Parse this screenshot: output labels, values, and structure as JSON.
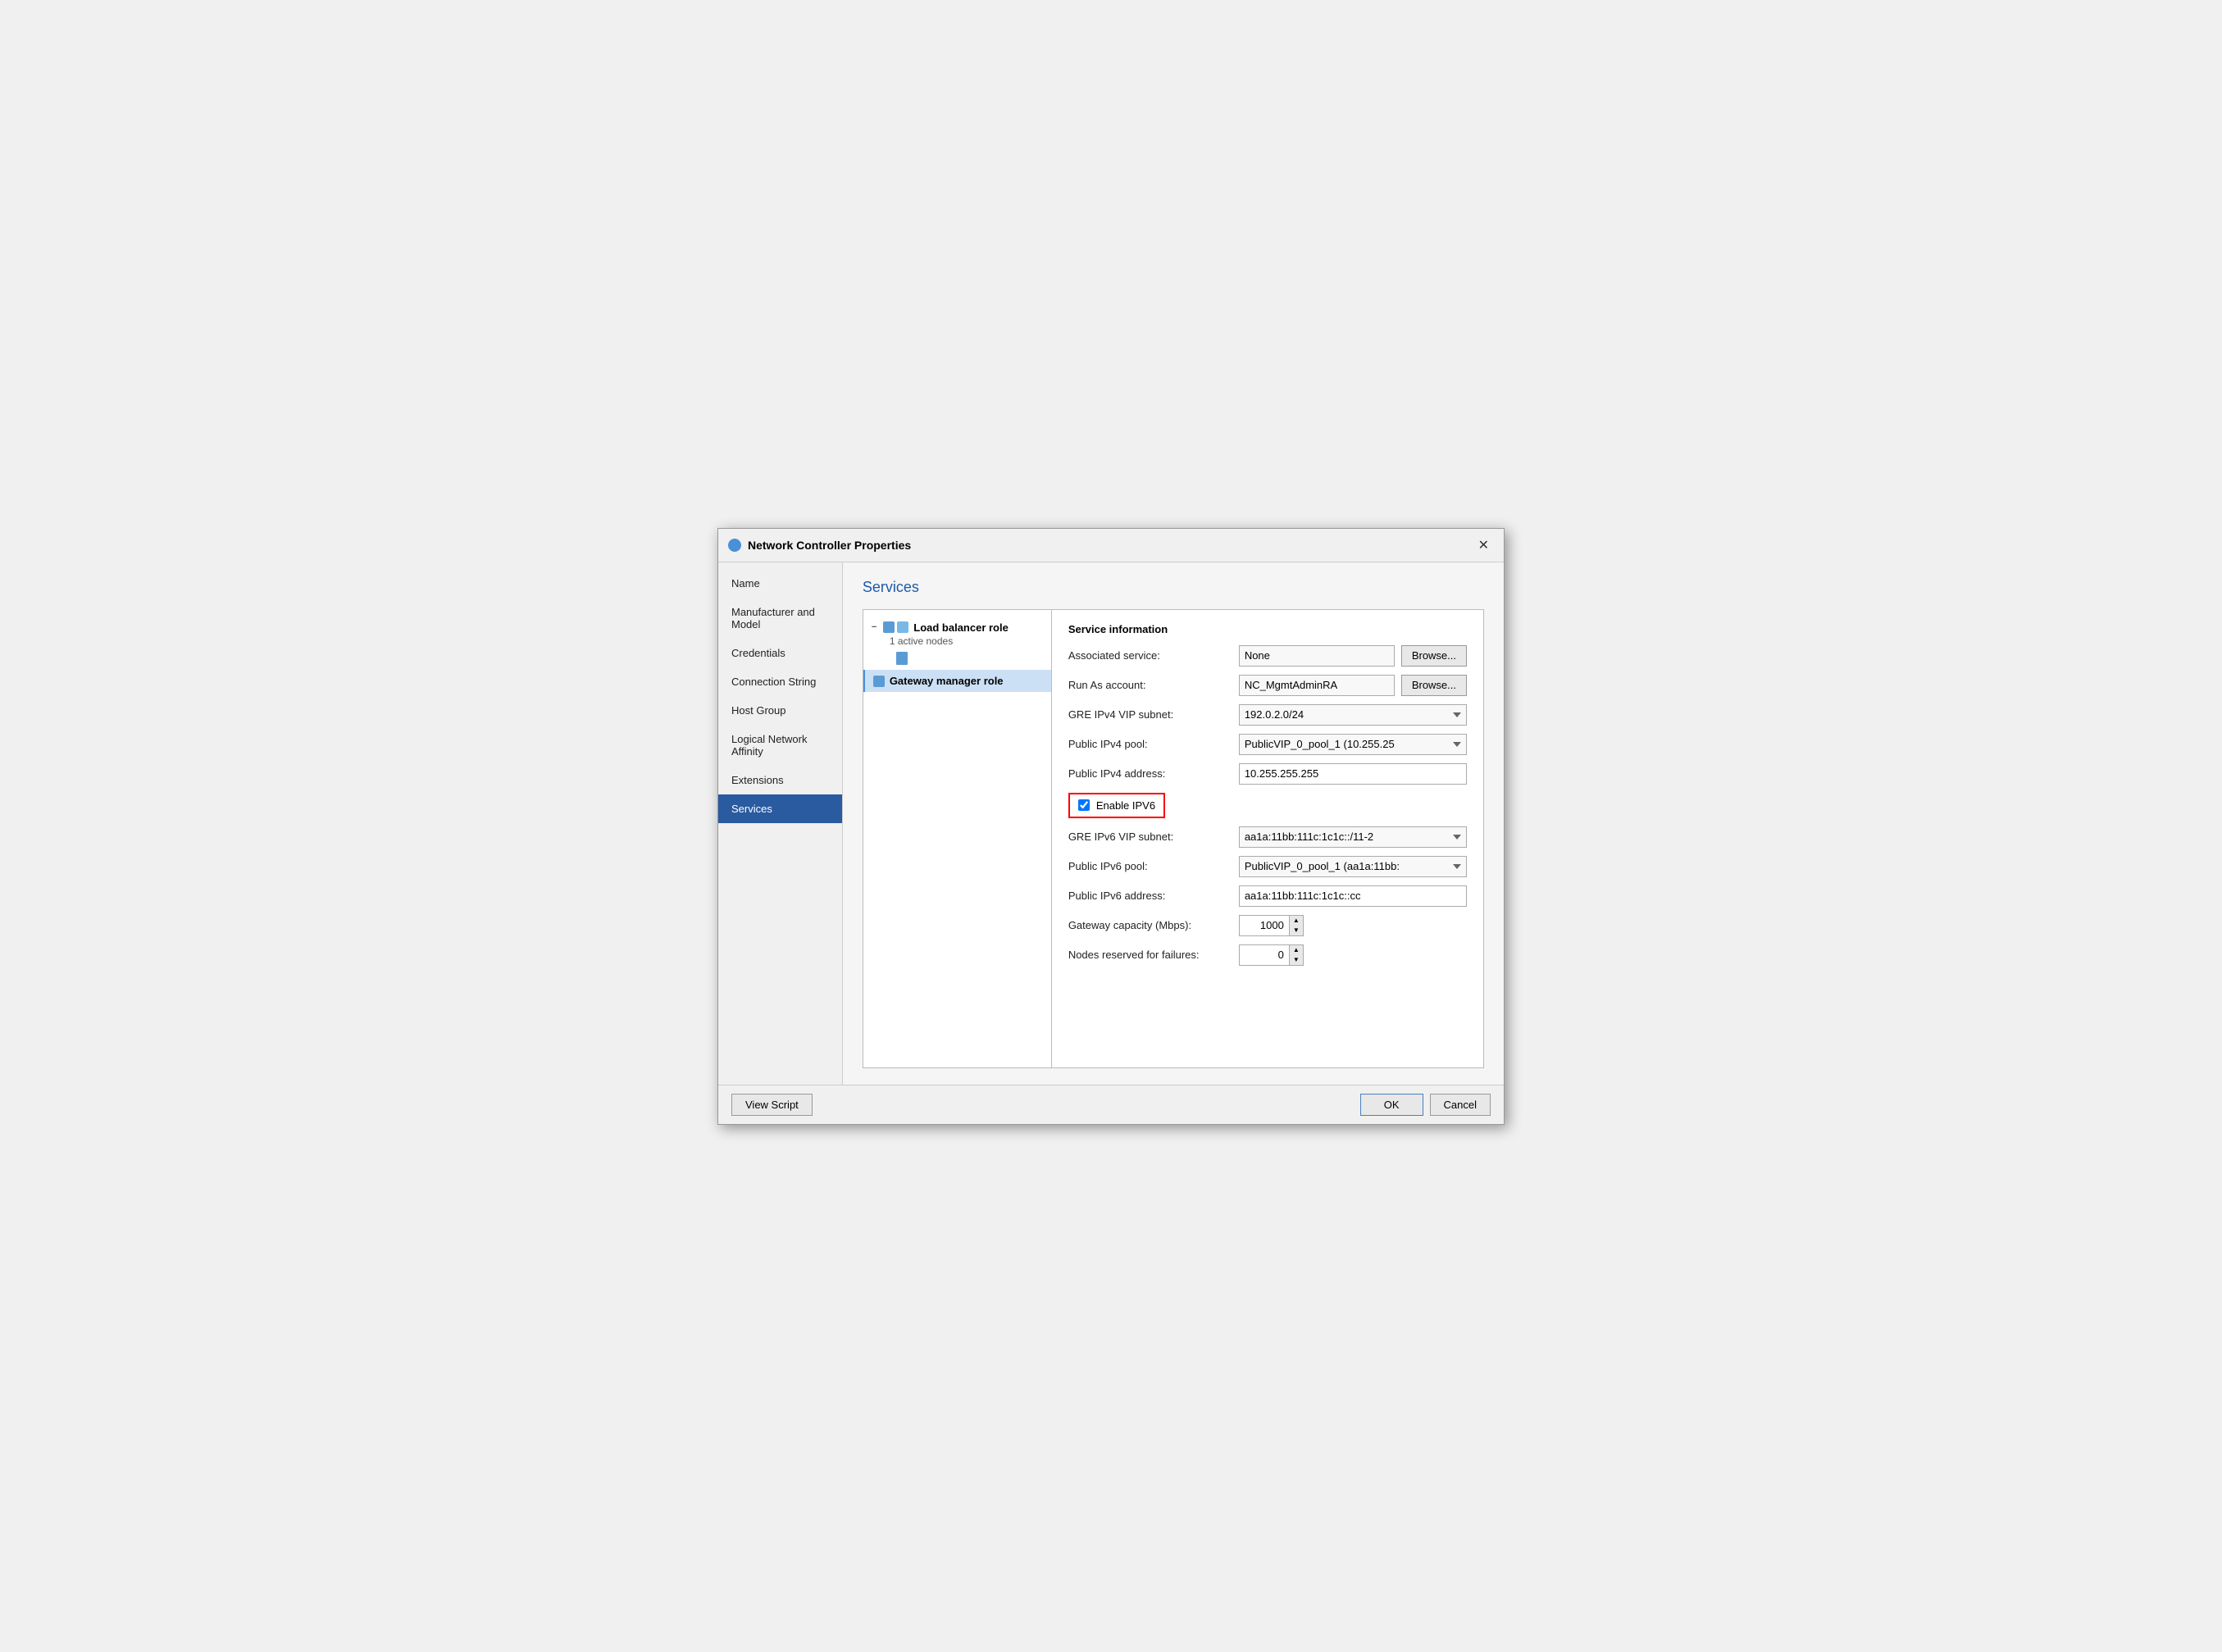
{
  "dialog": {
    "title": "Network Controller Properties",
    "close_label": "✕"
  },
  "sidebar": {
    "items": [
      {
        "id": "name",
        "label": "Name"
      },
      {
        "id": "manufacturer",
        "label": "Manufacturer and Model"
      },
      {
        "id": "credentials",
        "label": "Credentials"
      },
      {
        "id": "connection-string",
        "label": "Connection String"
      },
      {
        "id": "host-group",
        "label": "Host Group"
      },
      {
        "id": "logical-network",
        "label": "Logical Network Affinity"
      },
      {
        "id": "extensions",
        "label": "Extensions"
      },
      {
        "id": "services",
        "label": "Services"
      }
    ]
  },
  "main": {
    "section_title": "Services",
    "tree": {
      "load_balancer": {
        "label": "Load balancer role",
        "sub": "1 active nodes",
        "icon": "lb-icon"
      },
      "gateway_manager": {
        "label": "Gateway manager role",
        "icon": "gw-icon"
      }
    },
    "service_info": {
      "title": "Service information",
      "fields": {
        "associated_service_label": "Associated service:",
        "associated_service_value": "None",
        "run_as_label": "Run As account:",
        "run_as_value": "NC_MgmtAdminRA",
        "gre_ipv4_label": "GRE IPv4 VIP subnet:",
        "gre_ipv4_value": "192.0.2.0/24",
        "public_ipv4_pool_label": "Public IPv4 pool:",
        "public_ipv4_pool_value": "PublicVIP_0_pool_1 (10.255.25",
        "public_ipv4_addr_label": "Public IPv4 address:",
        "public_ipv4_addr_value": "10.255.255.255",
        "enable_ipv6_label": "Enable IPV6",
        "gre_ipv6_label": "GRE IPv6 VIP subnet:",
        "gre_ipv6_value": "aa1a:11bb:111c:1c1c::/11-2",
        "public_ipv6_pool_label": "Public IPv6 pool:",
        "public_ipv6_pool_value": "PublicVIP_0_pool_1 (aa1a:11bb:",
        "public_ipv6_addr_label": "Public IPv6 address:",
        "public_ipv6_addr_value": "aa1a:11bb:111c:1c1c::cc",
        "gateway_capacity_label": "Gateway capacity (Mbps):",
        "gateway_capacity_value": "1000",
        "nodes_reserved_label": "Nodes reserved for failures:",
        "nodes_reserved_value": "0"
      },
      "browse_label": "Browse...",
      "browse_label2": "Browse..."
    }
  },
  "footer": {
    "view_script": "View Script",
    "ok": "OK",
    "cancel": "Cancel"
  }
}
